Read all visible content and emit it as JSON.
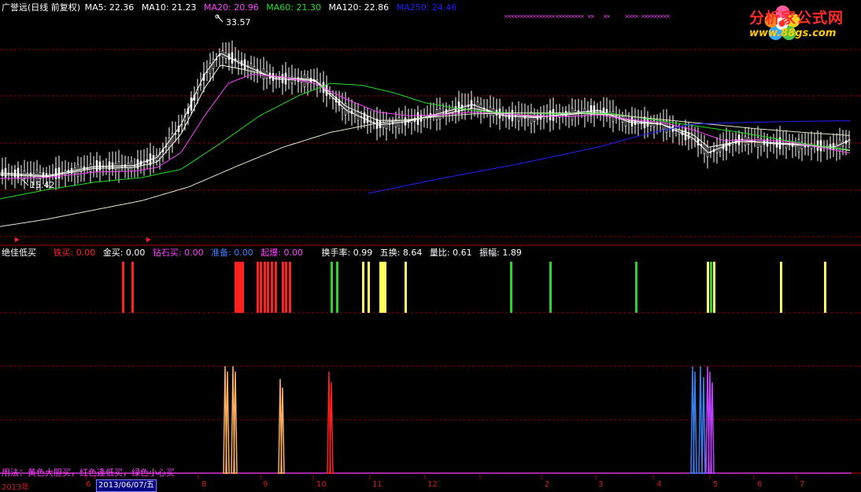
{
  "main_header": {
    "title": "广誉远(日线 前复权)",
    "items": [
      {
        "label": "MA5: 22.36",
        "color": "#ffffff"
      },
      {
        "label": "MA10: 21.23",
        "color": "#ffffff"
      },
      {
        "label": "MA20: 20.96",
        "color": "#ff40ff"
      },
      {
        "label": "MA60: 21.30",
        "color": "#20e020"
      },
      {
        "label": "MA120: 22.86",
        "color": "#ffffff"
      },
      {
        "label": "MA250: 24.46",
        "color": "#2020ff"
      }
    ]
  },
  "indicator_header": {
    "title": "绝佳低买",
    "items": [
      {
        "label": "铁买: 0.00",
        "color": "#ff2020"
      },
      {
        "label": "金买: 0.00",
        "color": "#ffffff"
      },
      {
        "label": "钻石买: 0.00",
        "color": "#ff40ff"
      },
      {
        "label": "准备: 0.00",
        "color": "#4080ff"
      },
      {
        "label": "起爆: 0.00",
        "color": "#ff40ff"
      },
      {
        "label": "换手率: 0.99",
        "color": "#ffffff"
      },
      {
        "label": "五换: 8.64",
        "color": "#ffffff"
      },
      {
        "label": "量比: 0.61",
        "color": "#ffffff"
      },
      {
        "label": "振幅: 1.89",
        "color": "#ffffff"
      }
    ]
  },
  "usage_note": "用法：黄色大胆买，红色逢低买，绿色小心买",
  "logo": {
    "name": "分析家公式网",
    "url": "www.88gs.com"
  },
  "time_axis": {
    "labels": [
      "2013年",
      "6",
      "8",
      "9",
      "10",
      "11",
      "12",
      "2",
      "3",
      "4",
      "5",
      "6",
      "7"
    ],
    "cursor_date": "2013/06/07/五"
  },
  "colors": {
    "background": "#000000",
    "grid": "#8b0000",
    "up": "#ffffff",
    "down": "#ffffff",
    "ma5": "#ffffff",
    "ma10": "#ffffee",
    "ma20": "#ff40ff",
    "ma60": "#20e020",
    "ma120": "#e6e6c8",
    "ma250": "#2020ff",
    "signal_red": "#ff2020",
    "signal_green": "#30d030",
    "signal_yellow": "#ffff60",
    "spike_orange": "#ffb060",
    "spike_blue": "#3a7ff0",
    "spike_magenta": "#c040ff"
  },
  "chart_data": [
    {
      "type": "line",
      "title": "广誉远(日线 前复权)",
      "price_high_label": "33.57",
      "price_low_label": "15.42",
      "ylim": [
        12,
        36
      ],
      "x_range": [
        0,
        1080
      ],
      "series": [
        {
          "name": "MA5",
          "x": [
            0,
            60,
            120,
            170,
            200,
            230,
            260,
            280,
            310,
            350,
            400,
            440,
            480,
            520,
            560,
            600,
            640,
            680,
            720,
            760,
            800,
            840,
            880,
            900,
            940,
            980,
            1020,
            1060,
            1080
          ],
          "values": [
            18.8,
            18.5,
            19.5,
            19.6,
            20.5,
            24,
            29.5,
            31.8,
            30.5,
            29,
            28.8,
            25.6,
            24,
            24.4,
            25.3,
            26.2,
            25,
            24.8,
            25.2,
            25.6,
            24.3,
            24.1,
            22.6,
            21,
            22.4,
            22,
            21.8,
            21.6,
            22.36
          ]
        },
        {
          "name": "MA10",
          "x": [
            0,
            60,
            120,
            170,
            200,
            230,
            260,
            280,
            310,
            350,
            400,
            440,
            480,
            520,
            560,
            600,
            640,
            680,
            720,
            760,
            800,
            840,
            880,
            900,
            940,
            980,
            1020,
            1060,
            1080
          ],
          "values": [
            18.6,
            18.4,
            19.3,
            19.4,
            20,
            23,
            28,
            30.5,
            30,
            29.2,
            28.9,
            26,
            24.5,
            24.5,
            25.1,
            25.8,
            25.2,
            24.9,
            25.1,
            25.4,
            24.5,
            24.1,
            23,
            21.6,
            22.2,
            22.1,
            21.9,
            21.5,
            21.23
          ]
        },
        {
          "name": "MA20",
          "x": [
            0,
            60,
            120,
            170,
            200,
            230,
            260,
            290,
            320,
            360,
            400,
            440,
            480,
            520,
            560,
            600,
            640,
            680,
            720,
            760,
            800,
            840,
            880,
            920,
            960,
            1000,
            1040,
            1080
          ],
          "values": [
            18.2,
            18.3,
            18.9,
            19,
            19.4,
            21,
            25,
            28.5,
            29.5,
            29.2,
            28.5,
            26.8,
            25.4,
            25,
            25.1,
            25.4,
            25.2,
            25,
            24.9,
            25.1,
            24.6,
            24.3,
            23.5,
            22.3,
            22.4,
            22.2,
            21.6,
            20.96
          ]
        },
        {
          "name": "MA60",
          "x": [
            0,
            60,
            120,
            180,
            230,
            280,
            330,
            380,
            420,
            460,
            500,
            540,
            580,
            620,
            660,
            700,
            740,
            780,
            820,
            860,
            900,
            940,
            980,
            1020,
            1060,
            1080
          ],
          "values": [
            16,
            17,
            17.8,
            18.3,
            19.2,
            22,
            25,
            27.2,
            28.5,
            28.3,
            27.5,
            26.4,
            25.8,
            25.4,
            25.3,
            25.2,
            25.3,
            25.2,
            24.7,
            24.2,
            23.7,
            23.2,
            22.6,
            22,
            21.5,
            21.3
          ]
        },
        {
          "name": "MA120",
          "x": [
            0,
            60,
            120,
            180,
            240,
            300,
            360,
            420,
            480,
            540,
            600,
            660,
            720,
            780,
            840,
            900,
            960,
            1020,
            1080
          ],
          "values": [
            13,
            13.8,
            14.8,
            15.8,
            17.3,
            19.5,
            21.6,
            23.2,
            24.2,
            24.8,
            25.2,
            25.3,
            25.3,
            25.1,
            24.6,
            24.1,
            23.6,
            23.2,
            22.86
          ]
        },
        {
          "name": "MA250",
          "x": [
            468,
            560,
            660,
            760,
            820,
            880,
            960,
            1020,
            1082
          ],
          "values": [
            16.6,
            18.2,
            19.8,
            21.6,
            23,
            24.1,
            24.3,
            24.4,
            24.46
          ]
        }
      ],
      "x_markers": [
        22,
        189
      ],
      "top_markers": [
        [
          640,
          700
        ],
        [
          705,
          740
        ],
        [
          746,
          752
        ],
        [
          766,
          772
        ],
        [
          794,
          806
        ],
        [
          814,
          848
        ]
      ]
    },
    {
      "type": "bar",
      "title": "绝佳低买",
      "ylim": [
        0,
        1
      ],
      "signals": [
        {
          "color": "signal_red",
          "x": [
            155,
            167,
            298,
            301,
            304,
            307,
            326,
            330,
            335,
            339,
            344,
            349,
            358,
            362,
            367
          ]
        },
        {
          "color": "signal_green",
          "x": [
            420,
            427,
            648,
            698,
            807,
            902
          ]
        },
        {
          "color": "signal_yellow",
          "x": [
            460,
            467,
            482,
            485,
            488,
            514,
            898,
            906,
            991,
            1047
          ]
        }
      ]
    },
    {
      "type": "bar",
      "title": "spikes",
      "ylim": [
        0,
        1
      ],
      "spikes": [
        {
          "color": "spike_orange",
          "x": [
            286,
            289,
            296,
            299,
            356,
            359
          ],
          "values": [
            1,
            0.95,
            1,
            0.95,
            0.88,
            0.8
          ]
        },
        {
          "color": "signal_red",
          "x": [
            418,
            421
          ],
          "values": [
            0.95,
            0.85
          ]
        },
        {
          "color": "spike_blue",
          "x": [
            880,
            883,
            890,
            894
          ],
          "values": [
            1,
            0.95,
            1,
            0.9
          ]
        },
        {
          "color": "spike_magenta",
          "x": [
            899,
            902,
            905
          ],
          "values": [
            1,
            0.95,
            0.85
          ]
        }
      ]
    }
  ]
}
